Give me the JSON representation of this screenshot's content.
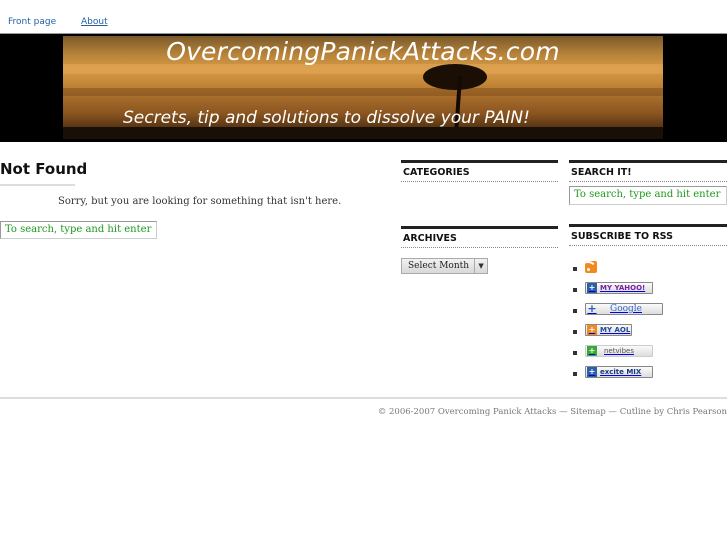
{
  "nav": {
    "items": [
      {
        "label": "Front page"
      },
      {
        "label": "About"
      }
    ]
  },
  "header": {
    "site_title": "OvercomingPanickAttacks.com",
    "tagline": "Secrets, tip and solutions to dissolve  your PAIN!"
  },
  "main": {
    "title": "Not Found",
    "message": "Sorry, but you are looking for something that isn't here.",
    "search_value": "To search, type and hit enter"
  },
  "sidebar_mid": {
    "categories_heading": "CATEGORIES",
    "archives_heading": "ARCHIVES",
    "archives_select": "Select Month"
  },
  "sidebar_right": {
    "search_heading": "SEARCH IT!",
    "search_value": "To search, type and hit enter",
    "rss_heading": "SUBSCRIBE TO RSS",
    "rss_items": [
      {
        "icon": "rss-feed-icon",
        "label": ""
      },
      {
        "icon": "my-yahoo-badge",
        "label": "MY YAHOO!"
      },
      {
        "icon": "google-badge",
        "label": "Google"
      },
      {
        "icon": "my-aol-badge",
        "label": "MY AOL"
      },
      {
        "icon": "netvibes-badge",
        "label": "netvibes"
      },
      {
        "icon": "excite-mix-badge",
        "label": "excite MIX"
      }
    ]
  },
  "footer": {
    "text": "© 2006-2007 Overcoming Panick Attacks — Sitemap — Cutline by Chris Pearson"
  },
  "colors": {
    "link": "#2361a1",
    "search_text": "#1d9a1d",
    "rss_orange": "#f28a1e"
  }
}
